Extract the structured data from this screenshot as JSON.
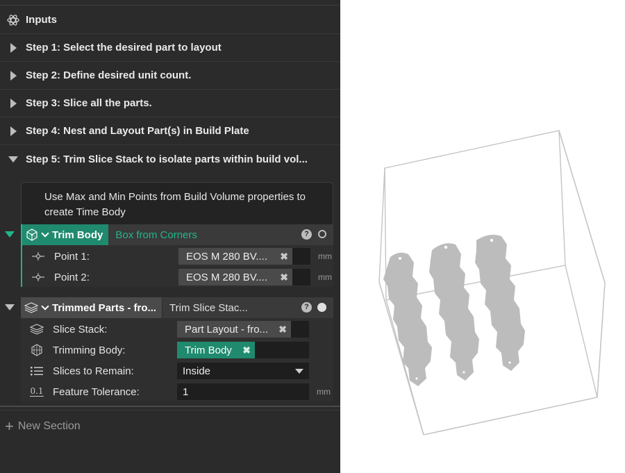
{
  "sections": {
    "inputs": "Inputs",
    "step1": "Step 1: Select the desired part to layout",
    "step2": "Step 2: Define desired unit count.",
    "step3": "Step 3: Slice all the parts.",
    "step4": "Step 4: Nest and Layout Part(s) in Build Plate",
    "step5": "Step 5: Trim Slice Stack to isolate parts within build vol..."
  },
  "note": "Use Max and Min Points from Build Volume properties to create Time Body",
  "trim_body": {
    "title": "Trim Body",
    "subtitle": "Box from Corners",
    "help": "?",
    "point1_label": "Point 1:",
    "point1_value": "EOS M 280 BV....",
    "point2_label": "Point 2:",
    "point2_value": "EOS M 280 BV....",
    "unit": "mm"
  },
  "trimmed_parts": {
    "title": "Trimmed Parts - fro...",
    "subtitle": "Trim Slice Stac...",
    "help": "?",
    "slice_stack_label": "Slice Stack:",
    "slice_stack_value": "Part Layout - fro...",
    "trimming_body_label": "Trimming Body:",
    "trimming_body_value": "Trim Body",
    "slices_label": "Slices to Remain:",
    "slices_value": "Inside",
    "tolerance_label": "Feature Tolerance:",
    "tolerance_value": "1",
    "tolerance_icon_text": "0.1",
    "unit": "mm"
  },
  "new_section": "New Section",
  "colors": {
    "accent": "#22b58c",
    "panel_bg": "#2b2b2b",
    "part_gray": "#bcbcbc",
    "box_line": "#c4c4c4"
  },
  "icons": [
    "atom-icon",
    "cube-wire-icon",
    "layers-icon",
    "trim-mesh-icon",
    "list-icon",
    "point-icon"
  ]
}
